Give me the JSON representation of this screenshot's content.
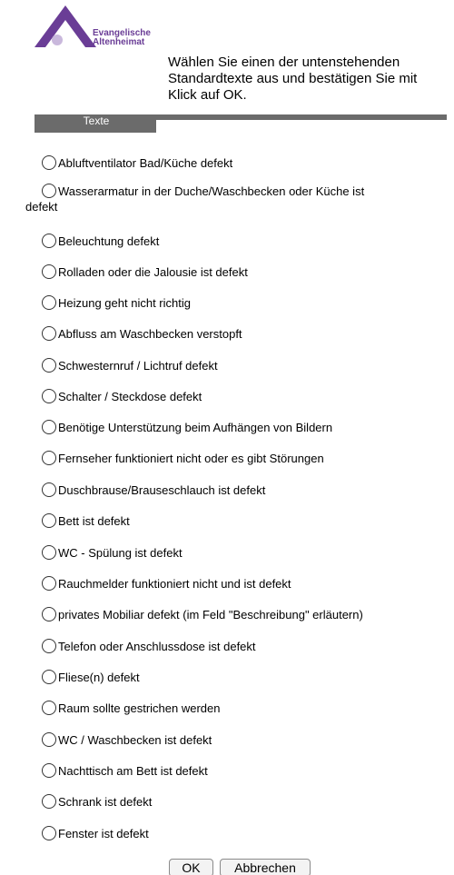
{
  "logo": {
    "line1": "Evangelische",
    "line2": "Altenheimat"
  },
  "instruction": "Wählen Sie einen der untenstehenden Standardtexte aus und bestätigen Sie mit Klick auf OK.",
  "tabs": [
    {
      "label": "Texte",
      "active": true
    }
  ],
  "options": [
    {
      "line1": "Abluftventilator Bad/Küche defekt"
    },
    {
      "line1": "Wasserarmatur in der Duche/Waschbecken oder Küche ist",
      "line2": "defekt"
    },
    {
      "line1": "Beleuchtung defekt"
    },
    {
      "line1": "Rolladen oder die Jalousie ist defekt"
    },
    {
      "line1": "Heizung geht nicht richtig"
    },
    {
      "line1": "Abfluss am Waschbecken verstopft"
    },
    {
      "line1": "Schwesternruf / Lichtruf defekt"
    },
    {
      "line1": "Schalter / Steckdose defekt"
    },
    {
      "line1": "Benötige Unterstützung beim Aufhängen von Bildern"
    },
    {
      "line1": "Fernseher funktioniert nicht oder es gibt Störungen"
    },
    {
      "line1": "Duschbrause/Brauseschlauch ist defekt"
    },
    {
      "line1": "Bett ist defekt"
    },
    {
      "line1": "WC - Spülung ist defekt"
    },
    {
      "line1": "Rauchmelder funktioniert nicht und ist defekt"
    },
    {
      "line1": "privates Mobiliar defekt (im Feld \"Beschreibung\" erläutern)"
    },
    {
      "line1": "Telefon oder Anschlussdose ist defekt"
    },
    {
      "line1": "Fliese(n) defekt"
    },
    {
      "line1": "Raum sollte gestrichen werden"
    },
    {
      "line1": "WC / Waschbecken ist defekt"
    },
    {
      "line1": "Nachttisch am Bett ist defekt"
    },
    {
      "line1": "Schrank ist defekt"
    },
    {
      "line1": "Fenster ist defekt"
    }
  ],
  "buttons": {
    "ok_label": "OK",
    "cancel_label": "Abbrechen"
  },
  "colors": {
    "brand": "#6a3d96",
    "tab": "#6b6b6b"
  }
}
